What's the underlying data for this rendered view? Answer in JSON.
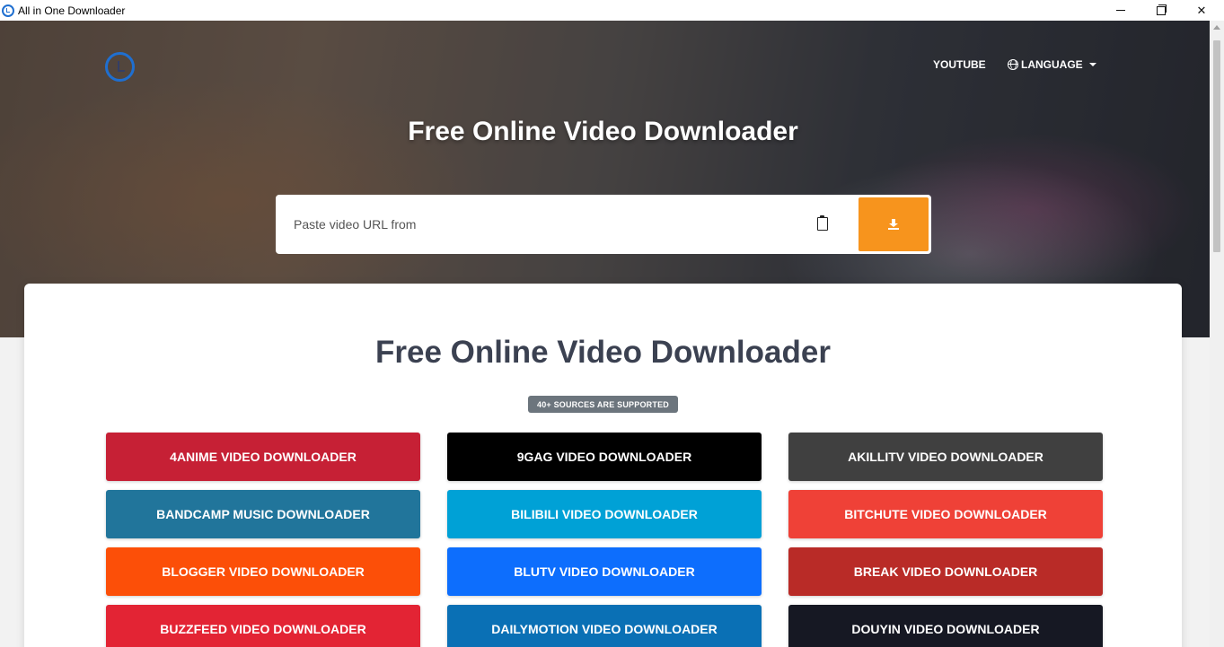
{
  "window": {
    "title": "All in One Downloader",
    "icon": "app-logo-icon",
    "controls": {
      "minimize": "minimize-icon",
      "maximize": "restore-icon",
      "close": "✕"
    }
  },
  "nav": {
    "youtube": "YOUTUBE",
    "language": "LANGUAGE"
  },
  "hero": {
    "title": "Free Online Video Downloader"
  },
  "search": {
    "placeholder": "Paste video URL from",
    "value": ""
  },
  "main": {
    "title": "Free Online Video Downloader",
    "badge": "40+ SOURCES ARE SUPPORTED",
    "downloaders": [
      {
        "label": "4ANIME VIDEO DOWNLOADER",
        "color": "#c62035"
      },
      {
        "label": "9GAG VIDEO DOWNLOADER",
        "color": "#000000"
      },
      {
        "label": "AKILLITV VIDEO DOWNLOADER",
        "color": "#404040"
      },
      {
        "label": "BANDCAMP MUSIC DOWNLOADER",
        "color": "#21759b"
      },
      {
        "label": "BILIBILI VIDEO DOWNLOADER",
        "color": "#00a1d6"
      },
      {
        "label": "BITCHUTE VIDEO DOWNLOADER",
        "color": "#ef4137"
      },
      {
        "label": "BLOGGER VIDEO DOWNLOADER",
        "color": "#fc4f08"
      },
      {
        "label": "BLUTV VIDEO DOWNLOADER",
        "color": "#0d6efd"
      },
      {
        "label": "BREAK VIDEO DOWNLOADER",
        "color": "#b92b27"
      },
      {
        "label": "BUZZFEED VIDEO DOWNLOADER",
        "color": "#e32434"
      },
      {
        "label": "DAILYMOTION VIDEO DOWNLOADER",
        "color": "#0a70b5"
      },
      {
        "label": "DOUYIN VIDEO DOWNLOADER",
        "color": "#161823"
      }
    ]
  },
  "colors": {
    "accent": "#f7941d",
    "logo": "#1f6fd0",
    "badge": "#6c757d",
    "title_text": "#3b4151"
  }
}
